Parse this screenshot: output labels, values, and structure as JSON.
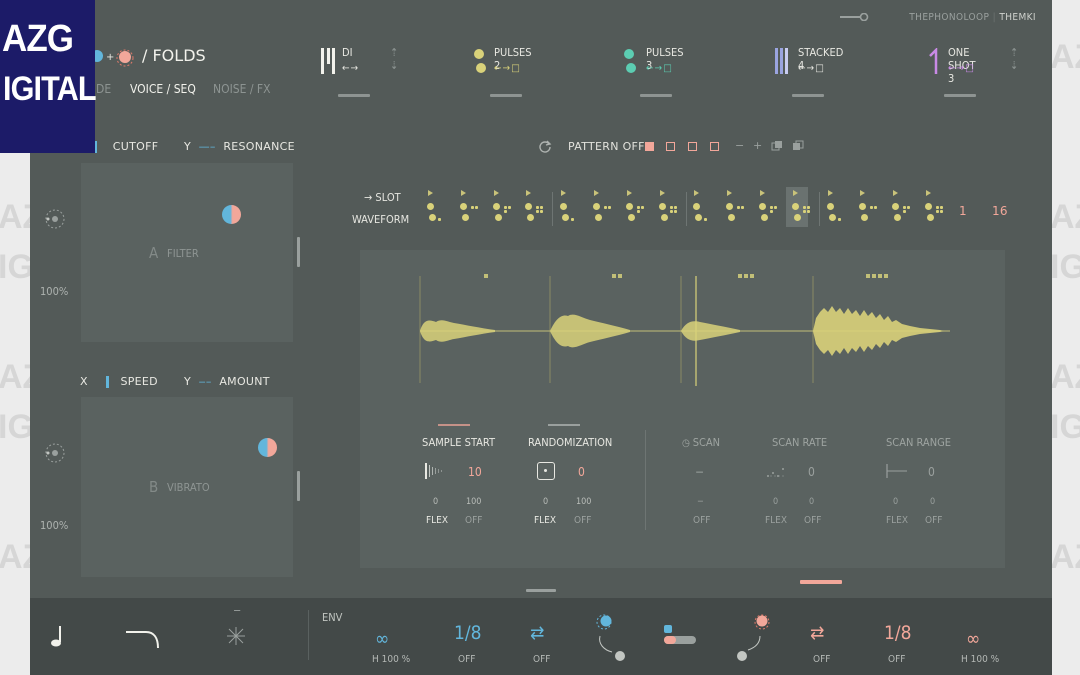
{
  "watermark": {
    "text": "AZG",
    "text2": "IGITAL"
  },
  "logo": {
    "line1": "AZG",
    "line2": "IGITAL"
  },
  "header": {
    "brand_light": "THEPHONOLOOP",
    "brand_bold": "THEMKI",
    "folds_title": "/ FOLDS",
    "tabs": [
      {
        "label": "DE"
      },
      {
        "label": "VOICE / SEQ"
      },
      {
        "label": "NOISE / FX"
      }
    ]
  },
  "slots": [
    {
      "name": "DI",
      "arrows": "←→",
      "icon": "bars-icon"
    },
    {
      "name": "PULSES 2",
      "arrows": "←→□",
      "icon": "dot-pair-icon"
    },
    {
      "name": "PULSES 3",
      "arrows": "←→□",
      "icon": "dot-pair-icon"
    },
    {
      "name": "STACKED 4",
      "arrows": "←→□",
      "icon": "stack-icon"
    },
    {
      "name": "ONE SHOT 3",
      "arrows": "←→□",
      "icon": "one-shot-icon"
    }
  ],
  "pads": {
    "a": {
      "x_label": "CUTOFF",
      "y_prefix": "Y",
      "y_label": "RESONANCE",
      "letter": "A",
      "name": "FILTER",
      "percent": "100%"
    },
    "b": {
      "x_prefix": "X",
      "x_label": "SPEED",
      "y_prefix": "Y",
      "y_label": "AMOUNT",
      "letter": "B",
      "name": "VIBRATO",
      "percent": "100%"
    }
  },
  "pattern": {
    "label": "PATTERN OFF",
    "symbols": [
      "−",
      "+"
    ]
  },
  "sequencer": {
    "slot_label": "→ SLOT",
    "waveform_label": "WAVEFORM",
    "count_a": "1",
    "count_b": "16"
  },
  "controls": {
    "sample_start": {
      "title": "SAMPLE START",
      "value": "10",
      "min": "0",
      "max": "100",
      "mode1": "FLEX",
      "mode2": "OFF"
    },
    "randomization": {
      "title": "RANDOMIZATION",
      "value": "0",
      "min": "0",
      "max": "100",
      "mode1": "FLEX",
      "mode2": "OFF"
    },
    "scan": {
      "title": "SCAN",
      "value": "−",
      "min": "−",
      "mode2": "OFF"
    },
    "scan_rate": {
      "title": "SCAN RATE",
      "value": "0",
      "min": "0",
      "max": "0",
      "mode1": "FLEX",
      "mode2": "OFF"
    },
    "scan_range": {
      "title": "SCAN RANGE",
      "value": "0",
      "min": "0",
      "max": "0",
      "mode1": "FLEX",
      "mode2": "OFF"
    }
  },
  "bottom": {
    "env_label": "ENV",
    "minus": "−",
    "items": [
      {
        "value": "∞",
        "sub": "H  100 %",
        "color": "#62b6dc"
      },
      {
        "value": "1/8",
        "sub": "OFF",
        "color": "#62b6dc"
      },
      {
        "value": "⇄",
        "sub": "OFF",
        "color": "#62b6dc"
      },
      {
        "value": "⇄",
        "sub": "OFF",
        "color": "#f2a79a"
      },
      {
        "value": "1/8",
        "sub": "OFF",
        "color": "#f2a79a"
      },
      {
        "value": "∞",
        "sub": "H  100 %",
        "color": "#f2a79a"
      }
    ]
  },
  "colors": {
    "accent_blue": "#62b6dc",
    "accent_pink": "#f2a79a",
    "accent_yellow": "#d9d27a",
    "panel": "#535a58"
  }
}
